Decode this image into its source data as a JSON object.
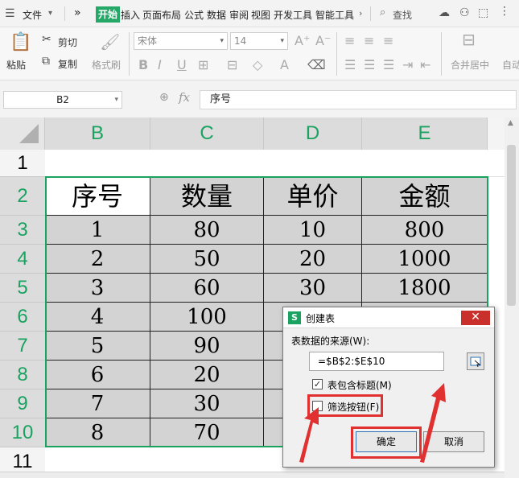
{
  "menubar": {
    "file": "文件",
    "more": "»",
    "tabs": [
      "开始",
      "插入",
      "页面布局",
      "公式",
      "数据",
      "审阅",
      "视图",
      "开发工具",
      "智能工具"
    ],
    "search": "查找"
  },
  "ribbon": {
    "paste": "粘贴",
    "cut": "剪切",
    "copy": "复制",
    "format_painter": "格式刷",
    "font_name": "宋体",
    "font_size": "14",
    "merge_center": "合并居中",
    "auto": "自动"
  },
  "formula_bar": {
    "name_box": "B2",
    "fx": "fx",
    "content": "序号"
  },
  "sheet": {
    "columns": [
      "B",
      "C",
      "D",
      "E"
    ],
    "rows": [
      "1",
      "2",
      "3",
      "4",
      "5",
      "6",
      "7",
      "8",
      "9",
      "10",
      "11"
    ],
    "headers": [
      "序号",
      "数量",
      "单价",
      "金额"
    ],
    "data": [
      [
        "1",
        "80",
        "10",
        "800"
      ],
      [
        "2",
        "50",
        "20",
        "1000"
      ],
      [
        "3",
        "60",
        "30",
        "1800"
      ],
      [
        "4",
        "100",
        "",
        ""
      ],
      [
        "5",
        "90",
        "",
        ""
      ],
      [
        "6",
        "20",
        "",
        ""
      ],
      [
        "7",
        "30",
        "",
        ""
      ],
      [
        "8",
        "70",
        "",
        ""
      ]
    ]
  },
  "dialog": {
    "title": "创建表",
    "logo": "S",
    "close": "✕",
    "source_label": "表数据的来源(W):",
    "source_value": "=$B$2:$E$10",
    "has_headers_label": "表包含标题(M)",
    "has_headers_checked": "✓",
    "filter_label": "筛选按钮(F)",
    "ok": "确定",
    "cancel": "取消"
  },
  "colors": {
    "accent": "#1aa260",
    "annotation": "#e03030"
  }
}
